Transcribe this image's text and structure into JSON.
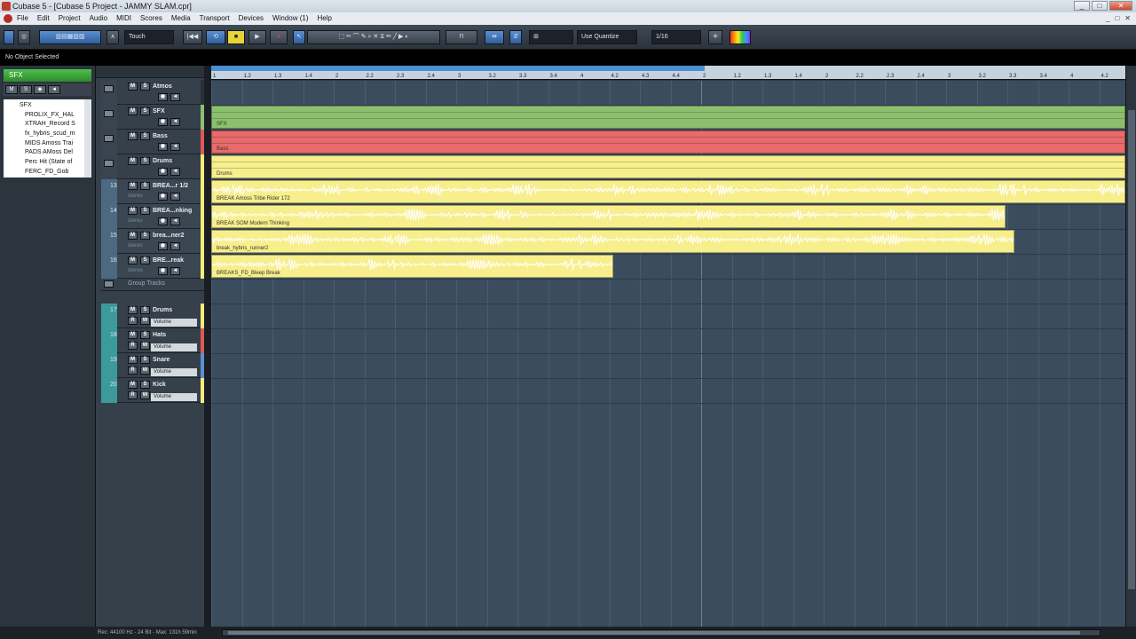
{
  "window": {
    "title": "Cubase 5 - [Cubase 5 Project - JAMMY SLAM.cpr]",
    "min": "_",
    "max": "□",
    "close": "✕"
  },
  "menu": [
    "File",
    "Edit",
    "Project",
    "Audio",
    "MIDI",
    "Scores",
    "Media",
    "Transport",
    "Devices",
    "Window (1)",
    "Help"
  ],
  "menu_right": [
    "_",
    "□",
    "✕"
  ],
  "toolbar": {
    "automation_mode": "Touch",
    "quantize_type": "Use Quantize",
    "quantize_value": "1/16",
    "transport": {
      "rewind": "|◀◀",
      "cycle": "⟲",
      "stop": "■",
      "play": "▶",
      "record": "●"
    },
    "icons": [
      "pointer-icon",
      "range-icon",
      "split-icon",
      "glue-icon",
      "erase-icon",
      "zoom-icon",
      "mute-icon",
      "time-warp-icon",
      "draw-icon",
      "line-icon",
      "play-tool-icon",
      "color-icon"
    ]
  },
  "infobar": {
    "text": "No Object Selected"
  },
  "inspector": {
    "track_name": "SFX",
    "tree_root": "SFX",
    "tree_items": [
      "PROLIX_FX_HAL",
      "XTRAH_Record S",
      "fx_hybris_scud_m",
      "MIDS Amoss Trai",
      "PADS AMoss Del",
      "Perc Hit (State of",
      "FERC_FD_Gob"
    ]
  },
  "tracks": [
    {
      "num": "",
      "name": "Atmos",
      "type": "folder",
      "color": "#2a2f36"
    },
    {
      "num": "",
      "name": "SFX",
      "type": "folder",
      "color": "#8dc06e"
    },
    {
      "num": "",
      "name": "Bass",
      "type": "folder",
      "color": "#e05858"
    },
    {
      "num": "",
      "name": "Drums",
      "type": "folder",
      "color": "#f5ea7a"
    },
    {
      "num": "13",
      "name": "BREA...r 1/2",
      "type": "audio",
      "io": "stereo",
      "color": "#f5ea7a"
    },
    {
      "num": "14",
      "name": "BREA...nking",
      "type": "audio",
      "io": "stereo",
      "color": "#f5ea7a"
    },
    {
      "num": "15",
      "name": "brea...ner2",
      "type": "audio",
      "io": "stereo",
      "color": "#f5ea7a"
    },
    {
      "num": "16",
      "name": "BRE...reak",
      "type": "audio",
      "io": "stereo",
      "color": "#f5ea7a"
    },
    {
      "num": "",
      "name": "Group Tracks",
      "type": "grouphead",
      "color": "#35404b"
    },
    {
      "num": "17",
      "name": "Drums",
      "type": "group",
      "vol": "Volume",
      "color": "#f5ea7a"
    },
    {
      "num": "18",
      "name": "Hats",
      "type": "group",
      "vol": "Volume",
      "color": "#e05858"
    },
    {
      "num": "19",
      "name": "Snare",
      "type": "group",
      "vol": "Volume",
      "color": "#5b8fd0"
    },
    {
      "num": "20",
      "name": "Kick",
      "type": "group",
      "vol": "Volume",
      "color": "#f5ea7a"
    }
  ],
  "buttons": {
    "mute": "M",
    "solo": "S",
    "read": "R",
    "write": "W"
  },
  "events": [
    {
      "label": "SFX",
      "color": "#8dc06e"
    },
    {
      "label": "Bass",
      "color": "#e86a6a"
    },
    {
      "label": "Drums",
      "color": "#f7ee8c"
    },
    {
      "label": "BREAK Amoss Tribe Rider 172",
      "color": "#f7ee8c"
    },
    {
      "label": "BREAK SOM Modern Thinking",
      "color": "#f7ee8c"
    },
    {
      "label": "break_hybris_runner2",
      "color": "#f7ee8c"
    },
    {
      "label": "BREAKS_FD_Bleep Break",
      "color": "#f7ee8c"
    }
  ],
  "ruler": {
    "labels": [
      "1",
      "1.2",
      "1.3",
      "1.4",
      "2",
      "2.2",
      "2.3",
      "2.4",
      "3",
      "3.2",
      "3.3",
      "3.4",
      "4",
      "4.2",
      "4.3",
      "4.4",
      "2",
      "1.2",
      "1.3",
      "1.4",
      "2",
      "2.2",
      "2.3",
      "2.4",
      "3",
      "3.2",
      "3.3",
      "3.4",
      "4",
      "4.2"
    ]
  },
  "status": {
    "text": "Rec: 44100 Hz - 24 Bit - Max: 131h 59min"
  }
}
